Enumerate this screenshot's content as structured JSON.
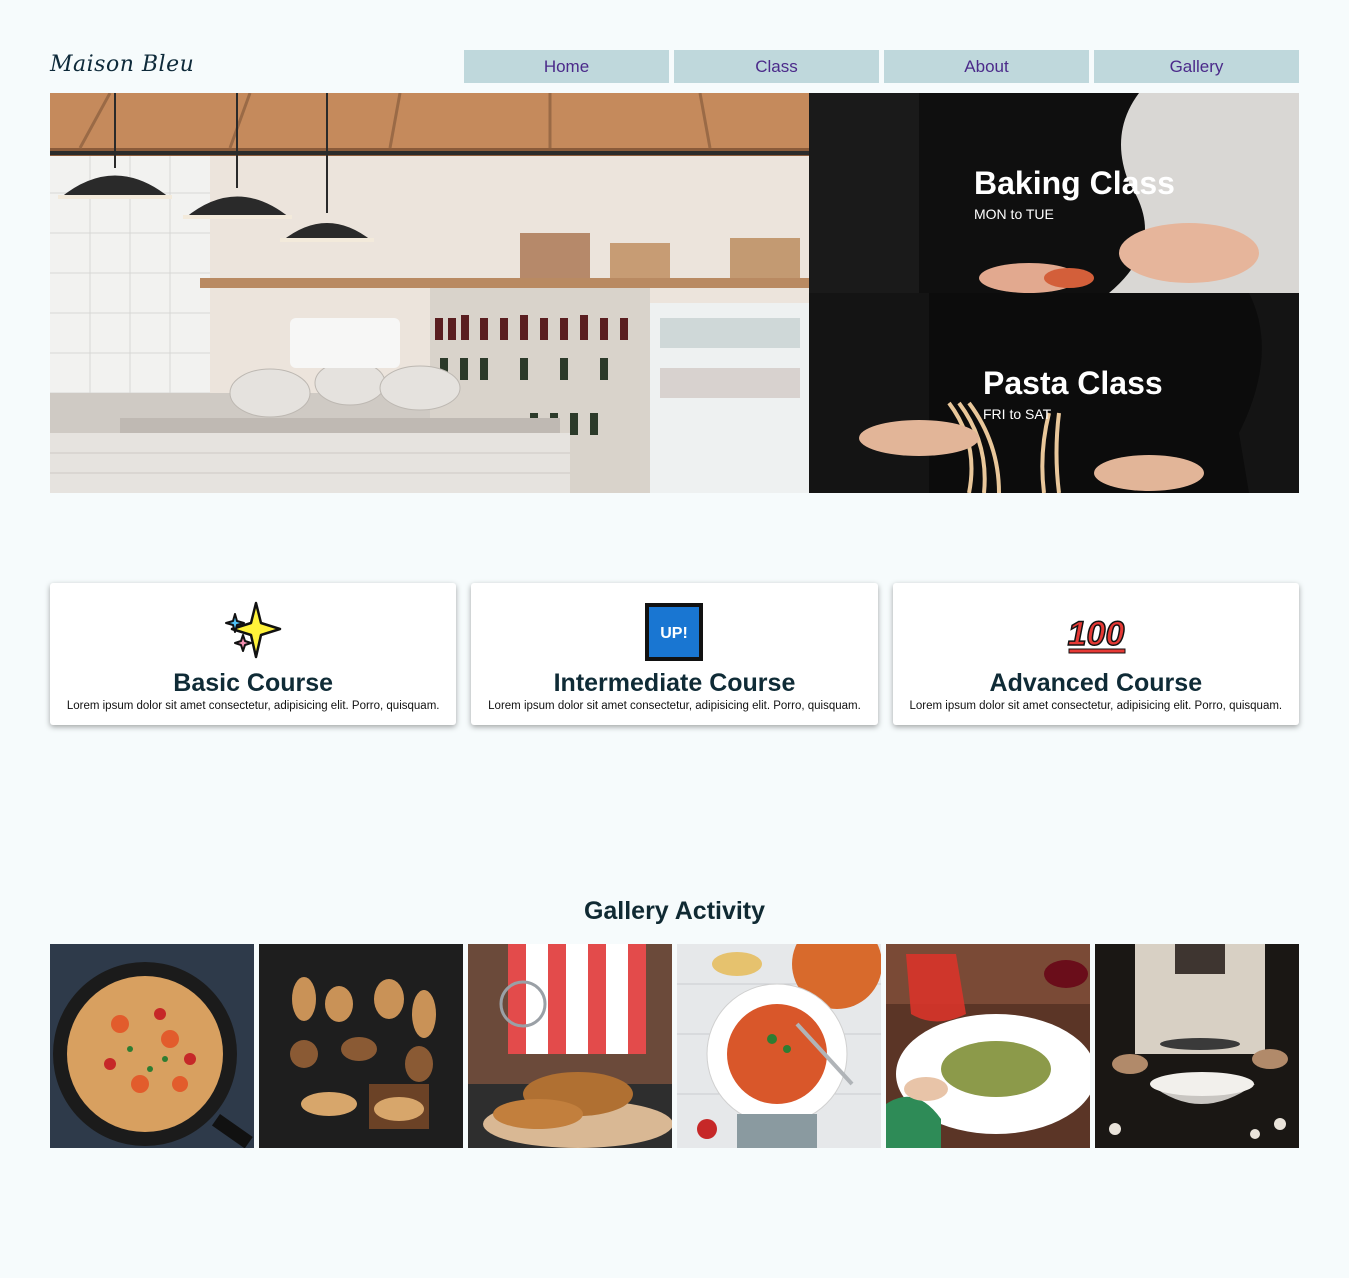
{
  "brand": {
    "logo": "Maison Bleu"
  },
  "nav": {
    "items": [
      "Home",
      "Class",
      "About",
      "Gallery"
    ]
  },
  "hero": {
    "classes": [
      {
        "title": "Baking Class",
        "days": "MON to TUE"
      },
      {
        "title": "Pasta Class",
        "days": "FRI to SAT"
      }
    ]
  },
  "courses": [
    {
      "icon": "sparkles-icon",
      "title": "Basic Course",
      "desc": "Lorem ipsum dolor sit amet consectetur, adipisicing elit. Porro, quisquam."
    },
    {
      "icon": "up-button-icon",
      "title": "Intermediate Course",
      "desc": "Lorem ipsum dolor sit amet consectetur, adipisicing elit. Porro, quisquam.",
      "icon_text": "UP!"
    },
    {
      "icon": "hundred-points-icon",
      "title": "Advanced Course",
      "desc": "Lorem ipsum dolor sit amet consectetur, adipisicing elit. Porro, quisquam.",
      "icon_text": "100"
    }
  ],
  "gallery": {
    "title": "Gallery Activity",
    "images": [
      "shrimp-pasta-pan",
      "assorted-breads",
      "dusting-croissants",
      "fusilli-pasta-plate",
      "pesto-pasta-dinner",
      "sifting-flour"
    ]
  },
  "colors": {
    "background": "#f6fbfc",
    "nav_bg": "#bfd8dc",
    "nav_text": "#4b2a8a",
    "heading": "#102a33"
  }
}
